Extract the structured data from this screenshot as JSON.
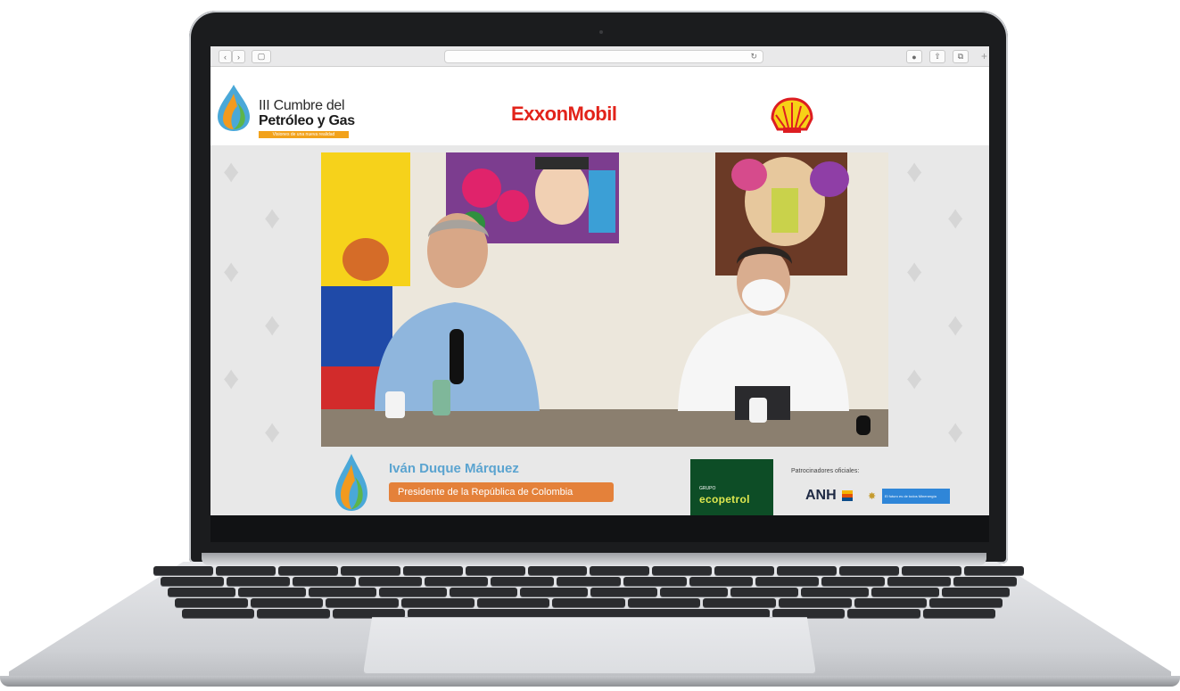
{
  "browser": {
    "back_icon": "chevron-left-icon",
    "forward_icon": "chevron-right-icon",
    "sidebar_icon": "sidebar-icon",
    "reload_icon": "reload-icon",
    "download_icon": "download-icon",
    "share_icon": "share-icon",
    "tabs_icon": "tabs-icon",
    "new_tab": "+",
    "back": "‹",
    "forward": "›",
    "sidebar": "▢",
    "reload": "↻",
    "download": "●",
    "share": "⇧",
    "tabs": "⧉"
  },
  "header": {
    "event_line1": "III Cumbre del",
    "event_line2": "Petróleo y Gas",
    "event_tagline": "Visiones de una nueva realidad",
    "sponsor1": "ExxonMobil",
    "sponsor2_icon": "shell-logo"
  },
  "lower_third": {
    "speaker_name": "Iván Duque Márquez",
    "speaker_role": "Presidente de la República de Colombia"
  },
  "sponsors": {
    "ecopetrol_small": "GRUPO",
    "ecopetrol_big": "ecopetrol",
    "official_label": "Patrocinadores oficiales:",
    "anh": "ANH",
    "minenergia": "El futuro es de todos  Minenergía"
  },
  "colors": {
    "exxon_red": "#e2231a",
    "orange": "#e4813a",
    "name_blue": "#5ba4d0",
    "ecopetrol_green": "#0d4d26"
  }
}
